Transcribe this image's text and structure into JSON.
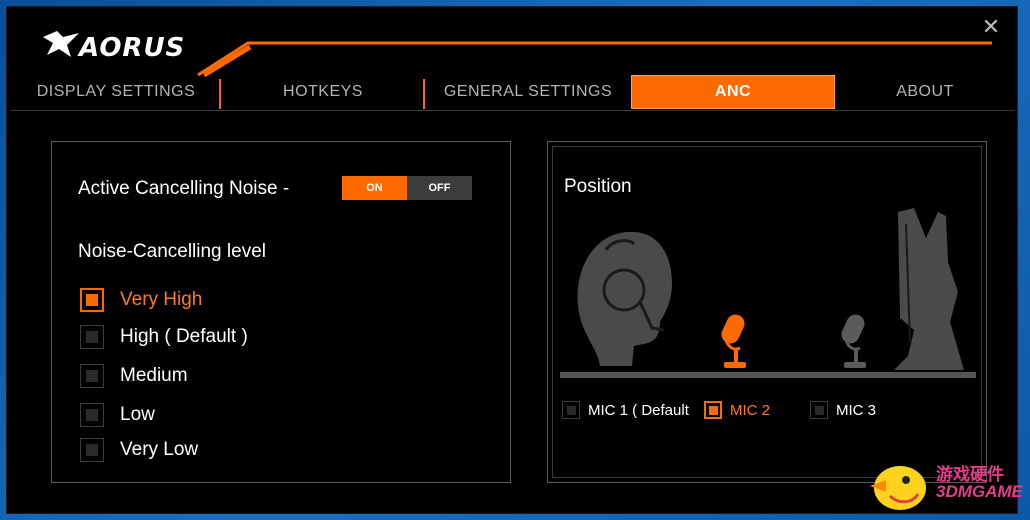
{
  "app": {
    "logo_text": "AORUS",
    "close_glyph": "✕",
    "accent_color": "#ff6a00"
  },
  "tabs": [
    {
      "label": "DISPLAY SETTINGS",
      "active": false
    },
    {
      "label": "HOTKEYS",
      "active": false
    },
    {
      "label": "GENERAL SETTINGS",
      "active": false
    },
    {
      "label": "ANC",
      "active": true
    },
    {
      "label": "ABOUT",
      "active": false
    }
  ],
  "anc": {
    "label": "Active Cancelling Noise -",
    "toggle_on": "ON",
    "toggle_off": "OFF",
    "state": "ON"
  },
  "level": {
    "title": "Noise-Cancelling level",
    "options": [
      {
        "label": "Very High",
        "selected": true
      },
      {
        "label": "High ( Default )",
        "selected": false
      },
      {
        "label": "Medium",
        "selected": false
      },
      {
        "label": "Low",
        "selected": false
      },
      {
        "label": "Very Low",
        "selected": false
      }
    ]
  },
  "position": {
    "title": "Position",
    "mics": [
      {
        "label": "MIC 1 ( Default",
        "selected": false
      },
      {
        "label": "MIC 2",
        "selected": true
      },
      {
        "label": "MIC 3",
        "selected": false
      }
    ]
  },
  "watermark": {
    "cn": "游戏硬件",
    "en": "3DMGAME"
  },
  "icons": [
    "aorus-logo-icon",
    "close-icon",
    "headset-head-icon",
    "microphone-icon",
    "monitor-icon"
  ]
}
